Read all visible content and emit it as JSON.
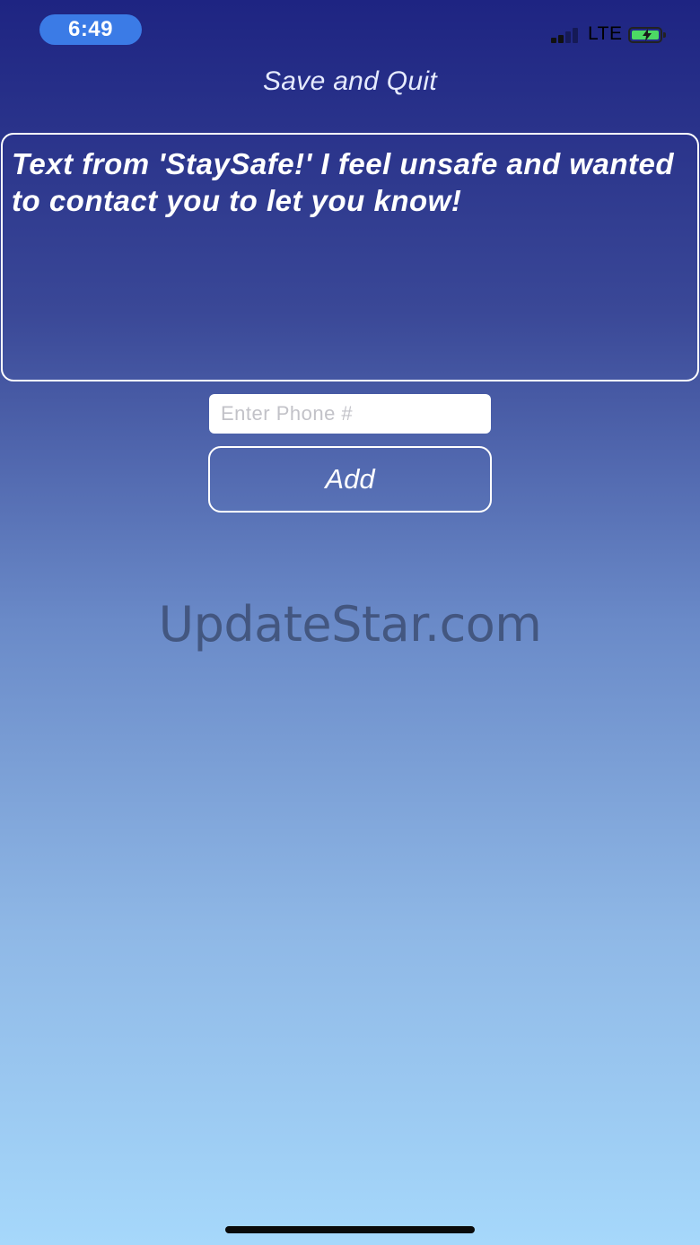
{
  "status_bar": {
    "time": "6:49",
    "network": "LTE",
    "icons": {
      "signal": "cellular-signal-icon",
      "battery": "battery-charging-icon"
    },
    "colors": {
      "time_pill": "#3b7be6",
      "battery_fill": "#4cd964"
    }
  },
  "header": {
    "save_quit_label": "Save and Quit"
  },
  "message": {
    "text": "Text from 'StaySafe!' I feel unsafe and wanted to contact you to let you know!"
  },
  "phone": {
    "value": "",
    "placeholder": "Enter Phone #"
  },
  "actions": {
    "add_label": "Add"
  },
  "watermark": {
    "text": "UpdateStar.com"
  }
}
